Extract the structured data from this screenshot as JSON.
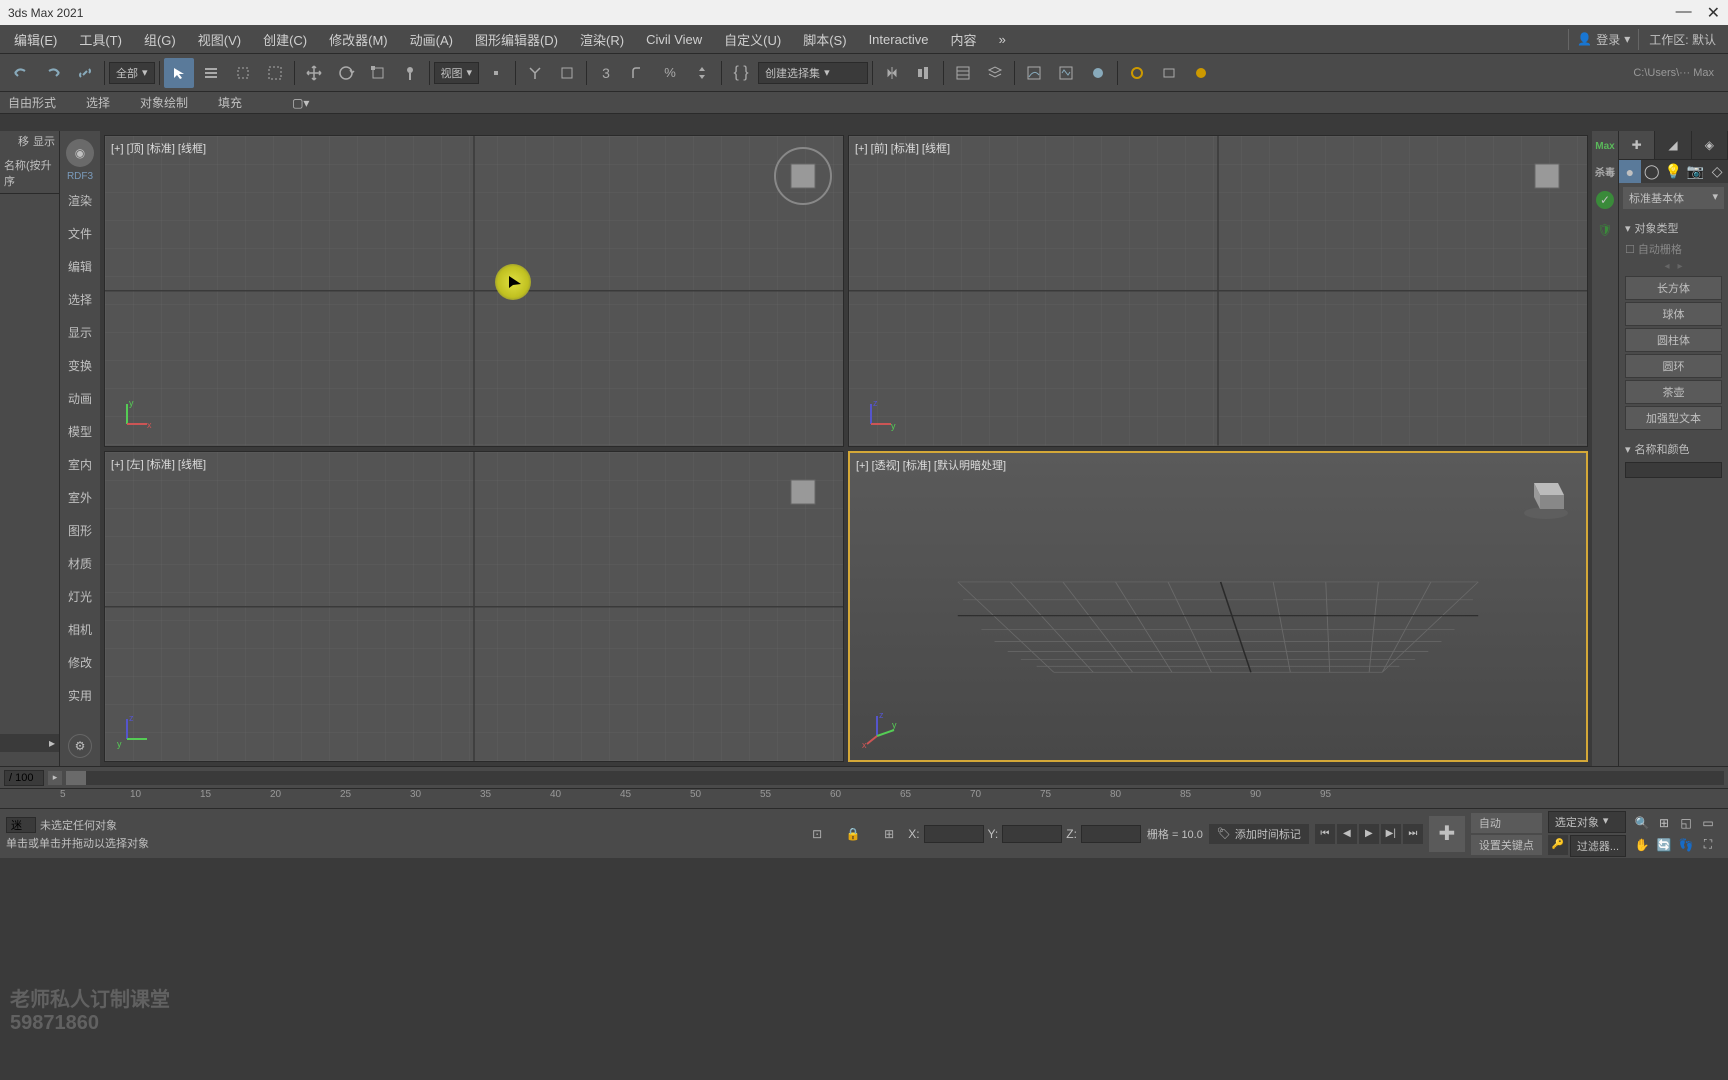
{
  "title": "3ds Max 2021",
  "window_controls": {
    "minimize": "—",
    "close": "✕"
  },
  "menubar": {
    "items": [
      "编辑(E)",
      "工具(T)",
      "组(G)",
      "视图(V)",
      "创建(C)",
      "修改器(M)",
      "动画(A)",
      "图形编辑器(D)",
      "渲染(R)",
      "Civil View",
      "自定义(U)",
      "脚本(S)",
      "Interactive",
      "内容"
    ],
    "overflow": "»",
    "login": "登录",
    "workspace_label": "工作区:",
    "workspace_value": "默认"
  },
  "toolbar": {
    "filter_dropdown": "全部",
    "view_dropdown": "视图",
    "selection_set": "创建选择集",
    "path": "C:\\Users\\··· Max"
  },
  "ribbon": {
    "items": [
      "自由形式",
      "选择",
      "对象绘制",
      "填充"
    ]
  },
  "left_panel": {
    "tab1": "移",
    "tab2": "显示",
    "header": "名称(按升序"
  },
  "quad_menu": {
    "label": "RDF3",
    "items": [
      "渲染",
      "文件",
      "编辑",
      "选择",
      "显示",
      "变换",
      "动画",
      "模型",
      "室内",
      "室外",
      "图形",
      "材质",
      "灯光",
      "相机",
      "修改",
      "实用"
    ]
  },
  "viewports": {
    "top": "[+] [顶] [标准] [线框]",
    "front": "[+] [前] [标准] [线框]",
    "left": "[+] [左] [标准] [线框]",
    "persp": "[+] [透视] [标准] [默认明暗处理]"
  },
  "right_collapse": {
    "label1": "Max",
    "label2": "杀毒"
  },
  "cmd_panel": {
    "category": "标准基本体",
    "rollout_object_type": "对象类型",
    "auto_grid": "自动栅格",
    "buttons": [
      "长方体",
      "球体",
      "圆柱体",
      "圆环",
      "茶壶",
      "加强型文本"
    ],
    "rollout_name_color": "名称和颜色"
  },
  "timeline": {
    "current": "/ 100",
    "ticks": [
      "5",
      "10",
      "15",
      "20",
      "25",
      "30",
      "35",
      "40",
      "45",
      "50",
      "55",
      "60",
      "65",
      "70",
      "75",
      "80",
      "85",
      "90",
      "95"
    ]
  },
  "statusbar": {
    "watermark_line1": "老师私人订制课堂",
    "watermark_line2": "59871860",
    "no_selection": "未选定任何对象",
    "hint": "单击或单击并拖动以选择对象",
    "mini_input": "迷",
    "x_label": "X:",
    "y_label": "Y:",
    "z_label": "Z:",
    "grid": "栅格 = 10.0",
    "time_tag": "添加时间标记",
    "auto": "自动",
    "set_key": "设置关键点",
    "selected_obj": "选定对象",
    "filter": "过滤器..."
  }
}
